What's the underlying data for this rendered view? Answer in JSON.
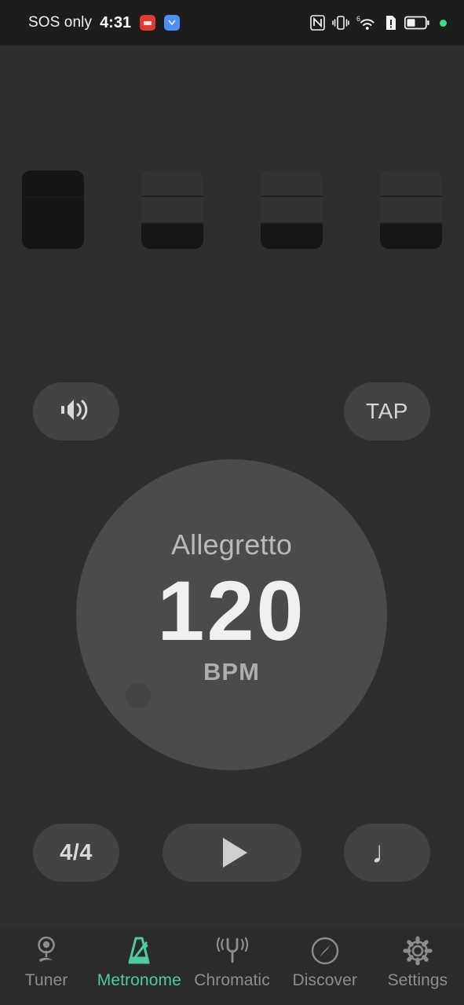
{
  "status_bar": {
    "carrier": "SOS only",
    "time": "4:31",
    "notifications": [
      {
        "name": "notification-badge-red",
        "color": "#e03b33"
      },
      {
        "name": "notification-badge-blue",
        "color": "#4d8ef7"
      }
    ],
    "icons": [
      "nfc-icon",
      "vibrate-icon",
      "wifi-6-icon",
      "sim-alert-icon",
      "battery-icon",
      "status-dot-green"
    ],
    "network_label": "6",
    "dot_color": "#3ddc84"
  },
  "beats": {
    "count": 4,
    "items": [
      {
        "index": 1,
        "accent": true
      },
      {
        "index": 2,
        "accent": false
      },
      {
        "index": 3,
        "accent": false
      },
      {
        "index": 4,
        "accent": false
      }
    ]
  },
  "controls": {
    "sound_icon": "speaker-volume-icon",
    "tap_label": "TAP",
    "time_signature": "4/4",
    "play_icon": "play-triangle-icon",
    "note_value": "♩"
  },
  "dial": {
    "tempo_marking": "Allegretto",
    "bpm": "120",
    "unit": "BPM"
  },
  "nav": {
    "active_color": "#4ecaa4",
    "inactive_color": "#8d8d8d",
    "items": [
      {
        "label": "Tuner",
        "icon": "tuning-peg-icon",
        "active": false
      },
      {
        "label": "Metronome",
        "icon": "metronome-icon",
        "active": true
      },
      {
        "label": "Chromatic",
        "icon": "tuning-fork-icon",
        "active": false
      },
      {
        "label": "Discover",
        "icon": "compass-icon",
        "active": false
      },
      {
        "label": "Settings",
        "icon": "gear-icon",
        "active": false
      }
    ]
  }
}
